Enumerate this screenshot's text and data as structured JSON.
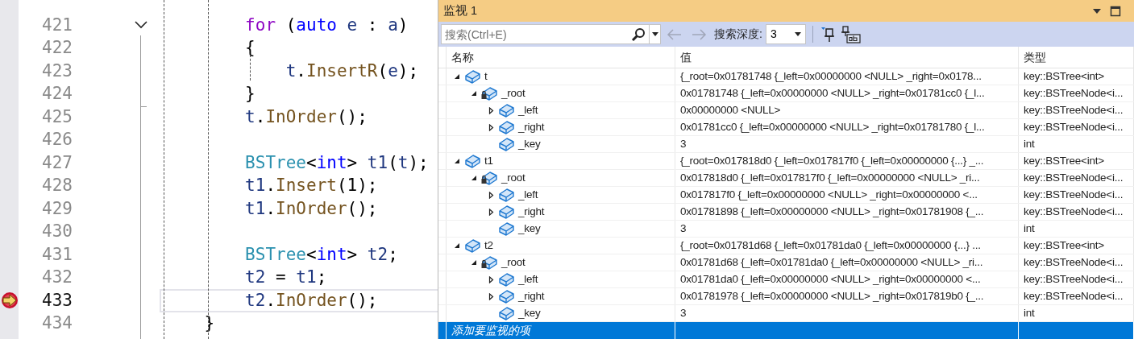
{
  "editor": {
    "lines": [
      {
        "number": "421",
        "kind": "block",
        "current": false,
        "foldable": true,
        "tokens": [
          {
            "text": "for",
            "kind": "keyword"
          },
          {
            "text": " (",
            "kind": "punct"
          },
          {
            "text": "auto",
            "kind": "type"
          },
          {
            "text": " e",
            "kind": "variable"
          },
          {
            "text": " : ",
            "kind": "punct"
          },
          {
            "text": "a",
            "kind": "variable"
          },
          {
            "text": ")",
            "kind": "punct"
          }
        ]
      },
      {
        "number": "422",
        "kind": "block",
        "current": false,
        "foldable": false,
        "tokens": [
          {
            "text": "{",
            "kind": "punct"
          }
        ]
      },
      {
        "number": "423",
        "kind": "nested",
        "current": false,
        "foldable": false,
        "tokens": [
          {
            "text": "t",
            "kind": "variable"
          },
          {
            "text": ".",
            "kind": "punct"
          },
          {
            "text": "InsertR",
            "kind": "method"
          },
          {
            "text": "(",
            "kind": "punct"
          },
          {
            "text": "e",
            "kind": "variable"
          },
          {
            "text": ");",
            "kind": "punct"
          }
        ]
      },
      {
        "number": "424",
        "kind": "block",
        "current": false,
        "foldable": false,
        "tokens": [
          {
            "text": "}",
            "kind": "punct"
          }
        ]
      },
      {
        "number": "425",
        "kind": "block",
        "current": false,
        "foldable": false,
        "tokens": [
          {
            "text": "t",
            "kind": "variable"
          },
          {
            "text": ".",
            "kind": "punct"
          },
          {
            "text": "InOrder",
            "kind": "method"
          },
          {
            "text": "();",
            "kind": "punct"
          }
        ]
      },
      {
        "number": "426",
        "kind": "blank",
        "current": false,
        "foldable": false
      },
      {
        "number": "427",
        "kind": "block",
        "current": false,
        "foldable": false,
        "tokens": [
          {
            "text": "BSTree",
            "kind": "class"
          },
          {
            "text": "<",
            "kind": "punct"
          },
          {
            "text": "int",
            "kind": "type"
          },
          {
            "text": ">",
            "kind": "punct"
          },
          {
            "text": " t1",
            "kind": "variable"
          },
          {
            "text": "(",
            "kind": "punct"
          },
          {
            "text": "t",
            "kind": "variable"
          },
          {
            "text": ");",
            "kind": "punct"
          }
        ]
      },
      {
        "number": "428",
        "kind": "block",
        "current": false,
        "foldable": false,
        "tokens": [
          {
            "text": "t1",
            "kind": "variable"
          },
          {
            "text": ".",
            "kind": "punct"
          },
          {
            "text": "Insert",
            "kind": "method"
          },
          {
            "text": "(1);",
            "kind": "punct"
          }
        ]
      },
      {
        "number": "429",
        "kind": "block",
        "current": false,
        "foldable": false,
        "tokens": [
          {
            "text": "t1",
            "kind": "variable"
          },
          {
            "text": ".",
            "kind": "punct"
          },
          {
            "text": "InOrder",
            "kind": "method"
          },
          {
            "text": "();",
            "kind": "punct"
          }
        ]
      },
      {
        "number": "430",
        "kind": "blank",
        "current": false,
        "foldable": false
      },
      {
        "number": "431",
        "kind": "block",
        "current": false,
        "foldable": false,
        "tokens": [
          {
            "text": "BSTree",
            "kind": "class"
          },
          {
            "text": "<",
            "kind": "punct"
          },
          {
            "text": "int",
            "kind": "type"
          },
          {
            "text": ">",
            "kind": "punct"
          },
          {
            "text": " t2",
            "kind": "variable"
          },
          {
            "text": ";",
            "kind": "punct"
          }
        ]
      },
      {
        "number": "432",
        "kind": "block",
        "current": false,
        "foldable": false,
        "tokens": [
          {
            "text": "t2",
            "kind": "variable"
          },
          {
            "text": " = ",
            "kind": "punct"
          },
          {
            "text": "t1",
            "kind": "variable"
          },
          {
            "text": ";",
            "kind": "punct"
          }
        ]
      },
      {
        "number": "433",
        "kind": "block",
        "current": true,
        "foldable": false,
        "tokens": [
          {
            "text": "t2",
            "kind": "variable"
          },
          {
            "text": ".",
            "kind": "punct"
          },
          {
            "text": "InOrder",
            "kind": "method"
          },
          {
            "text": "();",
            "kind": "punct"
          }
        ]
      },
      {
        "number": "434",
        "kind": "outer",
        "current": false,
        "foldable": false,
        "tokens": [
          {
            "text": "}",
            "kind": "punct"
          }
        ]
      }
    ]
  },
  "watch": {
    "title": "监视 1",
    "toolbar": {
      "search": {
        "placeholder": "搜索(Ctrl+E)"
      },
      "nav": [
        {
          "kind": "back",
          "disabled": true
        },
        {
          "kind": "forward",
          "disabled": true
        }
      ],
      "depth_label": "搜索深度:",
      "depth_value": "3"
    },
    "columns": [
      "名称",
      "值",
      "类型"
    ],
    "items": [
      {
        "name": "t",
        "kind": "field",
        "expandable": true,
        "expanded": true,
        "value": "{_root=0x01781748 {_left=0x00000000 <NULL> _right=0x0178...",
        "type": "key::BSTree<int>",
        "children": [
          {
            "name": "_root",
            "kind": "private",
            "expandable": true,
            "expanded": true,
            "value": "0x01781748 {_left=0x00000000 <NULL> _right=0x01781cc0 {_l...",
            "type": "key::BSTreeNode<i...",
            "children": [
              {
                "name": "_left",
                "kind": "field",
                "expandable": true,
                "expanded": false,
                "value": "0x00000000 <NULL>",
                "type": "key::BSTreeNode<i..."
              },
              {
                "name": "_right",
                "kind": "field",
                "expandable": true,
                "expanded": false,
                "value": "0x01781cc0 {_left=0x00000000 <NULL> _right=0x01781780 {_l...",
                "type": "key::BSTreeNode<i..."
              },
              {
                "name": "_key",
                "kind": "field",
                "expandable": false,
                "value": "3",
                "type": "int"
              }
            ]
          }
        ]
      },
      {
        "name": "t1",
        "kind": "field",
        "expandable": true,
        "expanded": true,
        "value": "{_root=0x017818d0 {_left=0x017817f0 {_left=0x00000000 {...} _...",
        "type": "key::BSTree<int>",
        "children": [
          {
            "name": "_root",
            "kind": "private",
            "expandable": true,
            "expanded": true,
            "value": "0x017818d0 {_left=0x017817f0 {_left=0x00000000 <NULL> _ri...",
            "type": "key::BSTreeNode<i...",
            "children": [
              {
                "name": "_left",
                "kind": "field",
                "expandable": true,
                "expanded": false,
                "value": "0x017817f0 {_left=0x00000000 <NULL> _right=0x00000000 <...",
                "type": "key::BSTreeNode<i..."
              },
              {
                "name": "_right",
                "kind": "field",
                "expandable": true,
                "expanded": false,
                "value": "0x01781898 {_left=0x00000000 <NULL> _right=0x01781908 {_...",
                "type": "key::BSTreeNode<i..."
              },
              {
                "name": "_key",
                "kind": "field",
                "expandable": false,
                "value": "3",
                "type": "int"
              }
            ]
          }
        ]
      },
      {
        "name": "t2",
        "kind": "field",
        "expandable": true,
        "expanded": true,
        "value": "{_root=0x01781d68 {_left=0x01781da0 {_left=0x00000000 {...} ...",
        "type": "key::BSTree<int>",
        "children": [
          {
            "name": "_root",
            "kind": "private",
            "expandable": true,
            "expanded": true,
            "value": "0x01781d68 {_left=0x01781da0 {_left=0x00000000 <NULL> _ri...",
            "type": "key::BSTreeNode<i...",
            "children": [
              {
                "name": "_left",
                "kind": "field",
                "expandable": true,
                "expanded": false,
                "value": "0x01781da0 {_left=0x00000000 <NULL> _right=0x00000000 <...",
                "type": "key::BSTreeNode<i..."
              },
              {
                "name": "_right",
                "kind": "field",
                "expandable": true,
                "expanded": false,
                "value": "0x01781978 {_left=0x00000000 <NULL> _right=0x017819b0 {_...",
                "type": "key::BSTreeNode<i..."
              },
              {
                "name": "_key",
                "kind": "field",
                "expandable": false,
                "value": "3",
                "type": "int"
              }
            ]
          }
        ]
      }
    ],
    "add_row": {
      "placeholder": "添加要监视的项",
      "selected": true
    }
  }
}
